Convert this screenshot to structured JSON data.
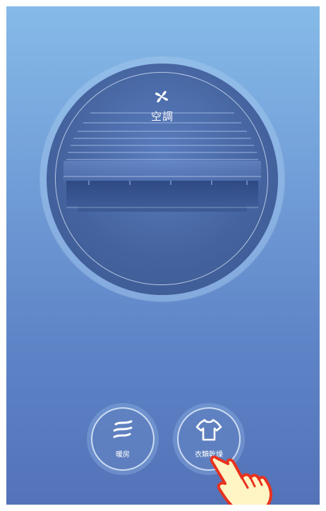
{
  "display": {
    "mode_icon": "fan-icon",
    "mode_label": "空調"
  },
  "buttons": [
    {
      "label": "暖房",
      "icon": "heat-waves-icon"
    },
    {
      "label": "衣類乾燥",
      "icon": "shirt-icon"
    }
  ],
  "pointer": {
    "icon": "pointing-hand-icon"
  },
  "colors": {
    "background_top": "#86bbe8",
    "background_bottom": "#5472b8",
    "dial": "#45649f",
    "hand_fill": "#fff4c4",
    "hand_outline": "#e8321e"
  }
}
